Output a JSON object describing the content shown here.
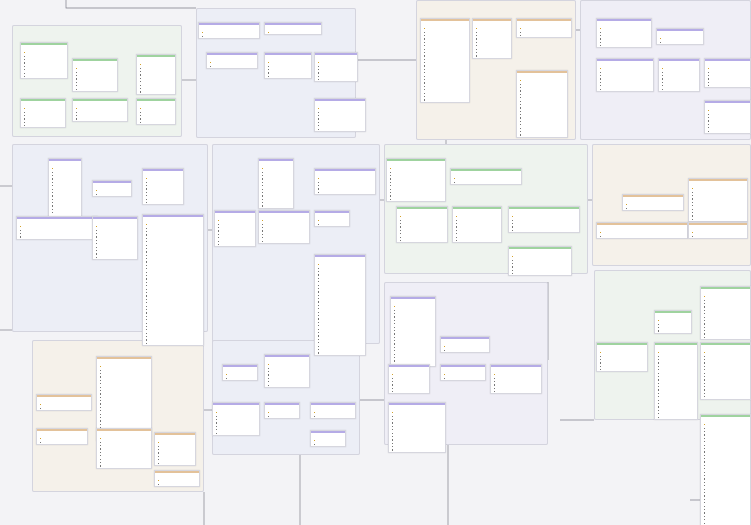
{
  "colors": {
    "green": "#9fd39f",
    "purple": "#b5abe6",
    "orange": "#e3c29a",
    "blue": "#a9b8e6",
    "wire": "#7c7c88"
  },
  "groups": [],
  "tables": []
}
